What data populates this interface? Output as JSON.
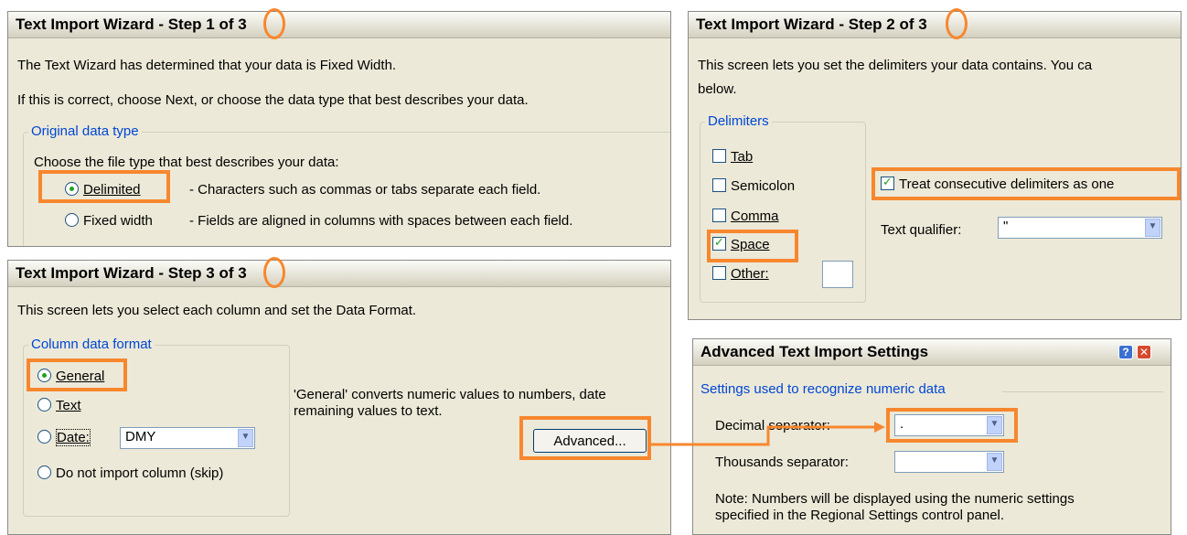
{
  "step1": {
    "title": "Text Import Wizard - Step 1 of 3",
    "line1": "The Text Wizard has determined that your data is Fixed Width.",
    "line2": "If this is correct, choose Next, or choose the data type that best describes your data.",
    "group_label": "Original data type",
    "choose_label": "Choose the file type that best describes your data:",
    "delimited_label": "Delimited",
    "delimited_desc": "- Characters such as commas or tabs separate each field.",
    "fixed_label": "Fixed width",
    "fixed_desc": "- Fields are aligned in columns with spaces between each field.",
    "selected": "Delimited"
  },
  "step2": {
    "title": "Text Import Wizard - Step 2 of 3",
    "line1": "This screen lets you set the delimiters your data contains.  You ca",
    "line2": "below.",
    "group_label": "Delimiters",
    "tab_label": "Tab",
    "semicolon_label": "Semicolon",
    "comma_label": "Comma",
    "space_label": "Space",
    "other_label": "Other:",
    "tab_checked": false,
    "semicolon_checked": false,
    "comma_checked": false,
    "space_checked": true,
    "other_checked": false,
    "consecutive_label": "Treat consecutive delimiters as one",
    "consecutive_checked": true,
    "qualifier_label": "Text qualifier:",
    "qualifier_value": "\""
  },
  "step3": {
    "title": "Text Import Wizard - Step 3 of 3",
    "line1": "This screen lets you select each column and set the Data Format.",
    "group_label": "Column data format",
    "general_label": "General",
    "text_label": "Text",
    "date_label": "Date:",
    "date_value": "DMY",
    "skip_label": "Do not import column (skip)",
    "selected": "General",
    "desc_line1": "'General' converts numeric values to numbers, date",
    "desc_line2": "remaining values to text.",
    "advanced_button": "Advanced..."
  },
  "advanced": {
    "title": "Advanced Text Import Settings",
    "group_label": "Settings used to recognize numeric data",
    "decimal_label": "Decimal separator:",
    "decimal_value": ".",
    "thousands_label": "Thousands separator:",
    "thousands_value": "",
    "note_line1": "Note: Numbers will be displayed using the numeric settings",
    "note_line2": "specified in the Regional Settings control panel."
  },
  "colors": {
    "highlight": "#f7872e",
    "dialog_bg": "#ece9d8",
    "group_label": "#0046d5"
  }
}
